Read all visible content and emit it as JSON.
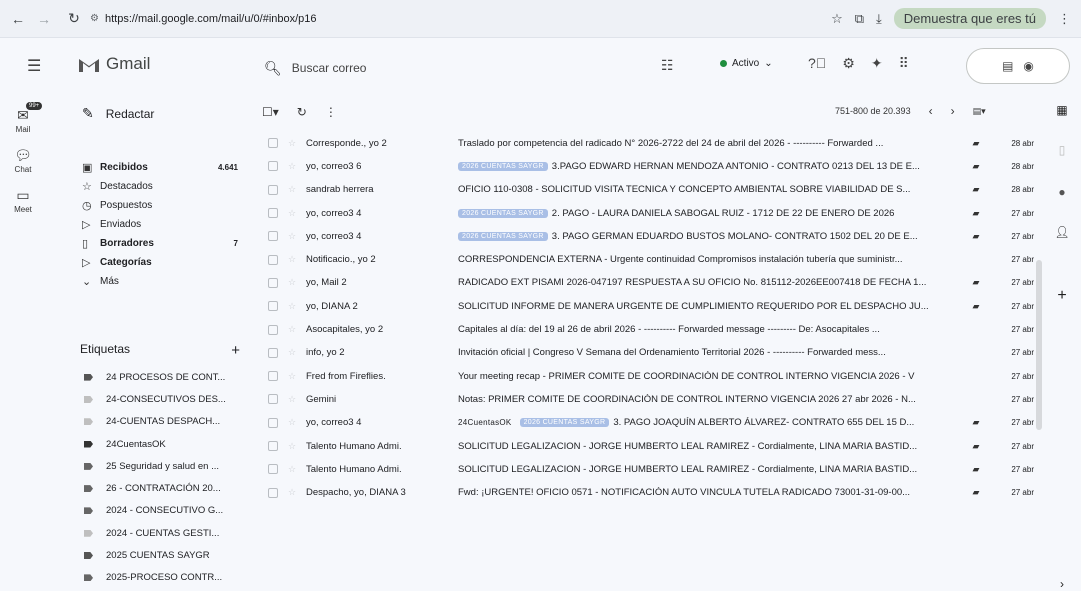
{
  "browser": {
    "url": "https://mail.google.com/mail/u/0/#inbox/p16",
    "profile_label": "Demuestra que eres tú"
  },
  "app": {
    "name": "Gmail",
    "search_placeholder": "Buscar correo",
    "status_label": "Activo",
    "status_color": "#1e8e3e"
  },
  "rail": {
    "mail_label": "Mail",
    "mail_badge": "99+",
    "chat_label": "Chat",
    "meet_label": "Meet"
  },
  "sidebar": {
    "compose_label": "Redactar",
    "items": [
      {
        "label": "Recibidos",
        "count": "4.641",
        "icon": "inbox-icon",
        "bold": true
      },
      {
        "label": "Destacados",
        "count": "",
        "icon": "star-icon",
        "bold": false
      },
      {
        "label": "Pospuestos",
        "count": "",
        "icon": "clock-icon",
        "bold": false
      },
      {
        "label": "Enviados",
        "count": "",
        "icon": "send-icon",
        "bold": false
      },
      {
        "label": "Borradores",
        "count": "7",
        "icon": "draft-icon",
        "bold": true
      },
      {
        "label": "Categorías",
        "count": "",
        "icon": "label-icon",
        "bold": true
      },
      {
        "label": "Más",
        "count": "",
        "icon": "chevron-down-icon",
        "bold": false
      }
    ],
    "labels_title": "Etiquetas",
    "labels": [
      {
        "name": "24 PROCESOS DE CONT...",
        "color": "#555555"
      },
      {
        "name": "24-CONSECUTIVOS DES...",
        "color": "#bfbfbf"
      },
      {
        "name": "24-CUENTAS DESPACH...",
        "color": "#bfbfbf"
      },
      {
        "name": "24CuentasOK",
        "color": "#333333"
      },
      {
        "name": "25 Seguridad y salud en ...",
        "color": "#666666"
      },
      {
        "name": "26 - CONTRATACIÓN 20...",
        "color": "#666666"
      },
      {
        "name": "2024 - CONSECUTIVO G...",
        "color": "#666666"
      },
      {
        "name": "2024 - CUENTAS GESTI...",
        "color": "#bfbfbf"
      },
      {
        "name": "2025 CUENTAS SAYGR",
        "color": "#555555"
      },
      {
        "name": "2025-PROCESO CONTR...",
        "color": "#666666"
      }
    ]
  },
  "list": {
    "pager": "751-800 de 20.393",
    "rows": [
      {
        "sender": "Corresponde., yo 2",
        "chip": "",
        "subject": "Traslado por competencia del radicado N° 2026-2722 del 24 de abril del 2026 - ---------- Forwarded ...",
        "attach": true,
        "date": "28 abr"
      },
      {
        "sender": "yo, correo3 6",
        "chip": "2026 CUENTAS SAYGR",
        "subject": "3.PAGO EDWARD HERNAN MENDOZA ANTONIO - CONTRATO 0213 DEL 13 DE E...",
        "attach": true,
        "date": "28 abr"
      },
      {
        "sender": "sandrab herrera",
        "chip": "",
        "subject": "OFICIO 110-0308 - SOLICITUD VISITA TECNICA Y CONCEPTO AMBIENTAL SOBRE VIABILIDAD DE S...",
        "attach": true,
        "date": "28 abr"
      },
      {
        "sender": "yo, correo3 4",
        "chip": "2026 CUENTAS SAYGR",
        "subject": "2. PAGO - LAURA DANIELA SABOGAL RUIZ - 1712 DE 22 DE ENERO DE 2026",
        "attach": true,
        "date": "27 abr"
      },
      {
        "sender": "yo, correo3 4",
        "chip": "2026 CUENTAS SAYGR",
        "subject": "3. PAGO GERMAN EDUARDO BUSTOS MOLANO- CONTRATO 1502 DEL 20 DE E...",
        "attach": true,
        "date": "27 abr"
      },
      {
        "sender": "Notificacio., yo 2",
        "chip": "",
        "subject": "CORRESPONDENCIA EXTERNA - Urgente continuidad Compromisos instalación tubería que suministr...",
        "attach": false,
        "date": "27 abr"
      },
      {
        "sender": "yo, Mail 2",
        "chip": "",
        "subject": "RADICADO EXT PISAMI 2026-047197 RESPUESTA A SU OFICIO No. 815112-2026EE007418 DE FECHA 1...",
        "attach": true,
        "date": "27 abr"
      },
      {
        "sender": "yo, DIANA 2",
        "chip": "",
        "subject": "SOLICITUD INFORME DE MANERA URGENTE DE CUMPLIMIENTO REQUERIDO POR EL DESPACHO JU...",
        "attach": true,
        "date": "27 abr"
      },
      {
        "sender": "Asocapitales, yo 2",
        "chip": "",
        "subject": "Capitales al día: del 19 al 26 de abril 2026 - ---------- Forwarded message --------- De: Asocapitales ...",
        "attach": false,
        "date": "27 abr"
      },
      {
        "sender": "info, yo 2",
        "chip": "",
        "subject": "Invitación oficial | Congreso V Semana del Ordenamiento Territorial 2026 - ---------- Forwarded mess...",
        "attach": false,
        "date": "27 abr"
      },
      {
        "sender": "Fred from Fireflies.",
        "chip": "",
        "subject": "Your meeting recap - PRIMER COMITE DE COORDINACIÓN DE CONTROL INTERNO VIGENCIA 2026 - V",
        "attach": false,
        "date": "27 abr"
      },
      {
        "sender": "Gemini",
        "chip": "",
        "subject": "Notas: PRIMER COMITE DE COORDINACIÓN DE CONTROL INTERNO VIGENCIA 2026 27 abr 2026 - N...",
        "attach": false,
        "date": "27 abr"
      },
      {
        "sender": "yo, correo3 4",
        "chip_plain": "24CuentasOK",
        "chip": "2026 CUENTAS SAYGR",
        "subject": "3. PAGO JOAQUÍN ALBERTO ÁLVAREZ- CONTRATO 655 DEL 15 D...",
        "attach": true,
        "date": "27 abr"
      },
      {
        "sender": "Talento Humano Admi.",
        "chip": "",
        "subject": "SOLICITUD LEGALIZACION - JORGE HUMBERTO LEAL RAMIREZ - Cordialmente, LINA MARIA BASTID...",
        "attach": true,
        "date": "27 abr"
      },
      {
        "sender": "Talento Humano Admi.",
        "chip": "",
        "subject": "SOLICITUD LEGALIZACION - JORGE HUMBERTO LEAL RAMIREZ - Cordialmente, LINA MARIA BASTID...",
        "attach": true,
        "date": "27 abr"
      },
      {
        "sender": "Despacho, yo, DIANA 3",
        "chip": "",
        "subject": "Fwd: ¡URGENTE! OFICIO 0571 - NOTIFICACIÓN AUTO VINCULA TUTELA RADICADO 73001-31-09-00...",
        "attach": true,
        "date": "27 abr"
      }
    ]
  }
}
